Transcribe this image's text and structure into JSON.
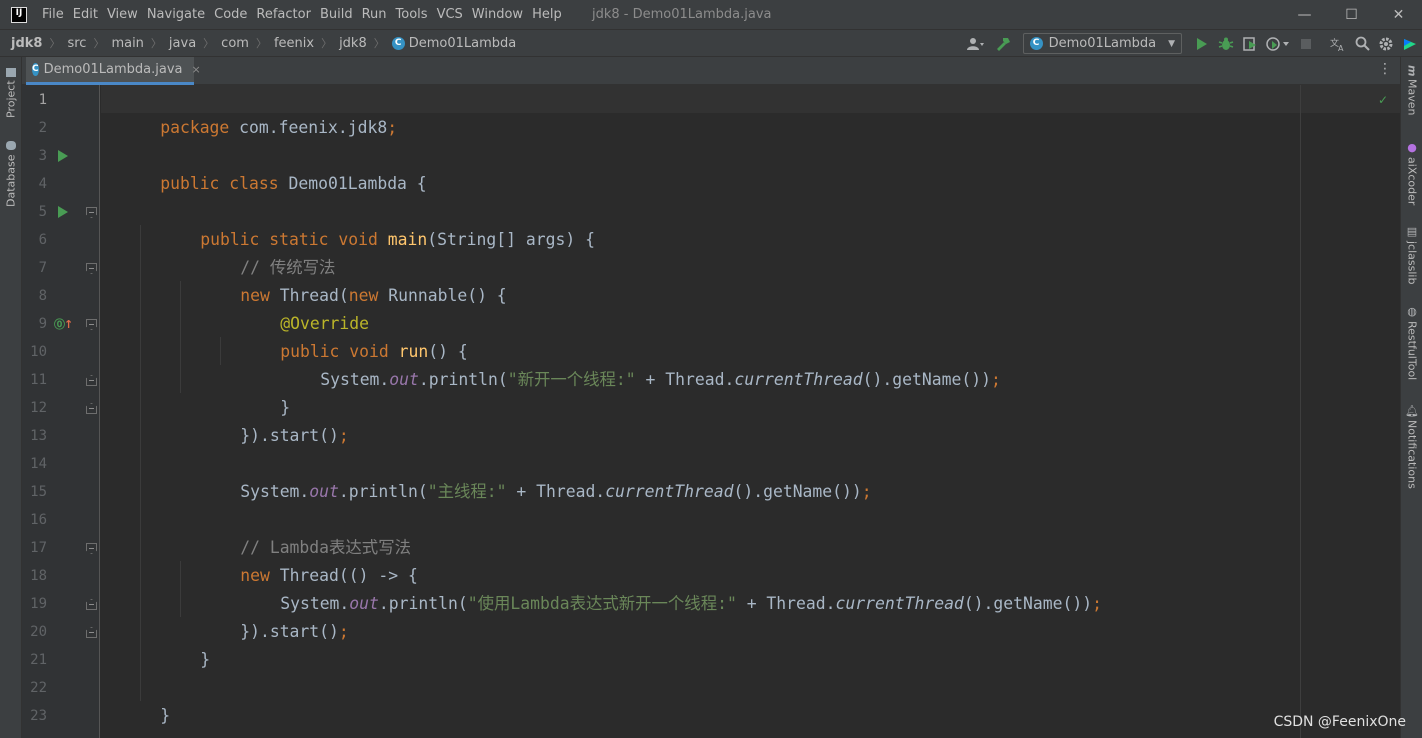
{
  "app": {
    "logo": "IJ",
    "window_title": "jdk8 - Demo01Lambda.java"
  },
  "menu": [
    "File",
    "Edit",
    "View",
    "Navigate",
    "Code",
    "Refactor",
    "Build",
    "Run",
    "Tools",
    "VCS",
    "Window",
    "Help"
  ],
  "window_controls": {
    "minimize": "—",
    "maximize": "☐",
    "close": "✕"
  },
  "breadcrumbs": [
    "jdk8",
    "src",
    "main",
    "java",
    "com",
    "feenix",
    "jdk8",
    "Demo01Lambda"
  ],
  "toolbar": {
    "run_config": "Demo01Lambda",
    "icons": [
      "user-icon",
      "build-hammer-icon",
      "run-icon",
      "debug-icon",
      "coverage-icon",
      "profile-icon",
      "stop-icon",
      "translate-icon",
      "search-icon",
      "settings-icon",
      "plugin-icon"
    ]
  },
  "left_tools": [
    "Project",
    "Database"
  ],
  "right_tools": [
    "Maven",
    "aiXcoder",
    "jclasslib",
    "RestfulTool",
    "Notifications"
  ],
  "tab": {
    "label": "Demo01Lambda.java",
    "close": "×"
  },
  "editor": {
    "line_numbers": [
      "1",
      "2",
      "3",
      "4",
      "5",
      "6",
      "7",
      "8",
      "9",
      "10",
      "11",
      "12",
      "13",
      "14",
      "15",
      "16",
      "17",
      "18",
      "19",
      "20",
      "21",
      "22",
      "23"
    ],
    "lines": {
      "l1": {
        "kw": "package",
        "rest": " com.feenix.jdk8",
        "semi": ";"
      },
      "l3": {
        "kw": "public class",
        "rest": " Demo01Lambda {"
      },
      "l5": {
        "kw": "public static void",
        "fn": "main",
        "rest": "(String[] args) {"
      },
      "l6": {
        "cmt": "// 传统写法"
      },
      "l7": {
        "kw1": "new",
        "mid": " Thread(",
        "kw2": "new",
        "rest": " Runnable() {"
      },
      "l8": {
        "ann": "@Override"
      },
      "l9": {
        "kw": "public void",
        "fn": "run",
        "rest": "() {"
      },
      "l10": {
        "a": "System.",
        "fld": "out",
        "b": ".println(",
        "str": "\"新开一个线程:\"",
        "c": " + Thread.",
        "ital": "currentThread",
        "d": "().getName())",
        "semi": ";"
      },
      "l11": {
        "rest": "}"
      },
      "l12": {
        "rest": "}).start()",
        "semi": ";"
      },
      "l14": {
        "a": "System.",
        "fld": "out",
        "b": ".println(",
        "str": "\"主线程:\"",
        "c": " + Thread.",
        "ital": "currentThread",
        "d": "().getName())",
        "semi": ";"
      },
      "l16": {
        "cmt": "// Lambda表达式写法"
      },
      "l17": {
        "kw": "new",
        "rest": " Thread(() -> {"
      },
      "l18": {
        "a": "System.",
        "fld": "out",
        "b": ".println(",
        "str": "\"使用Lambda表达式新开一个线程:\"",
        "c": " + Thread.",
        "ital": "currentThread",
        "d": "().getName())",
        "semi": ";"
      },
      "l19": {
        "rest": "}).start()",
        "semi": ";"
      },
      "l20": {
        "rest": "}"
      },
      "l22": {
        "rest": "}"
      }
    }
  },
  "inspection_status": "✓",
  "watermark": "CSDN @FeenixOne",
  "colors": {
    "keyword": "#cc7832",
    "string": "#6a8759",
    "comment": "#808080",
    "annotation": "#bbb529",
    "method_decl": "#ffc66d",
    "static_field": "#9876aa",
    "default_text": "#a9b7c6",
    "run_green": "#499c54",
    "tab_accent": "#4a88c7"
  }
}
